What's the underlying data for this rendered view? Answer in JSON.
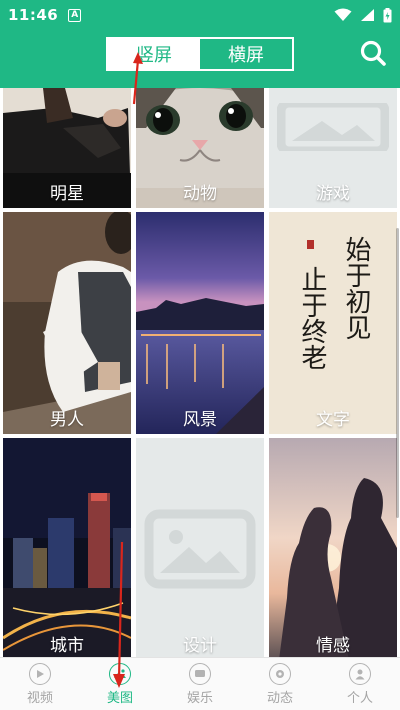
{
  "status_bar": {
    "time": "11:46",
    "app_icon_letter": "A"
  },
  "header": {
    "orientation_tabs": [
      {
        "label": "竖屏",
        "active": true
      },
      {
        "label": "横屏",
        "active": false
      }
    ],
    "search_icon": "search-icon"
  },
  "categories": [
    {
      "label": "明星"
    },
    {
      "label": "动物"
    },
    {
      "label": "游戏"
    },
    {
      "label": "男人"
    },
    {
      "label": "风景"
    },
    {
      "label": "文字"
    },
    {
      "label": "城市"
    },
    {
      "label": "设计"
    },
    {
      "label": "情感"
    }
  ],
  "calligraphy": [
    "始于初见",
    "止于终老"
  ],
  "bottom_nav": [
    {
      "label": "视频",
      "icon": "play-icon",
      "active": false
    },
    {
      "label": "美图",
      "icon": "image-icon",
      "active": true
    },
    {
      "label": "娱乐",
      "icon": "chat-icon",
      "active": false
    },
    {
      "label": "动态",
      "icon": "gear-icon",
      "active": false
    },
    {
      "label": "个人",
      "icon": "person-icon",
      "active": false
    }
  ],
  "colors": {
    "accent": "#1fb885",
    "inactive": "#a5a5a5",
    "annotation": "#d9261c"
  }
}
